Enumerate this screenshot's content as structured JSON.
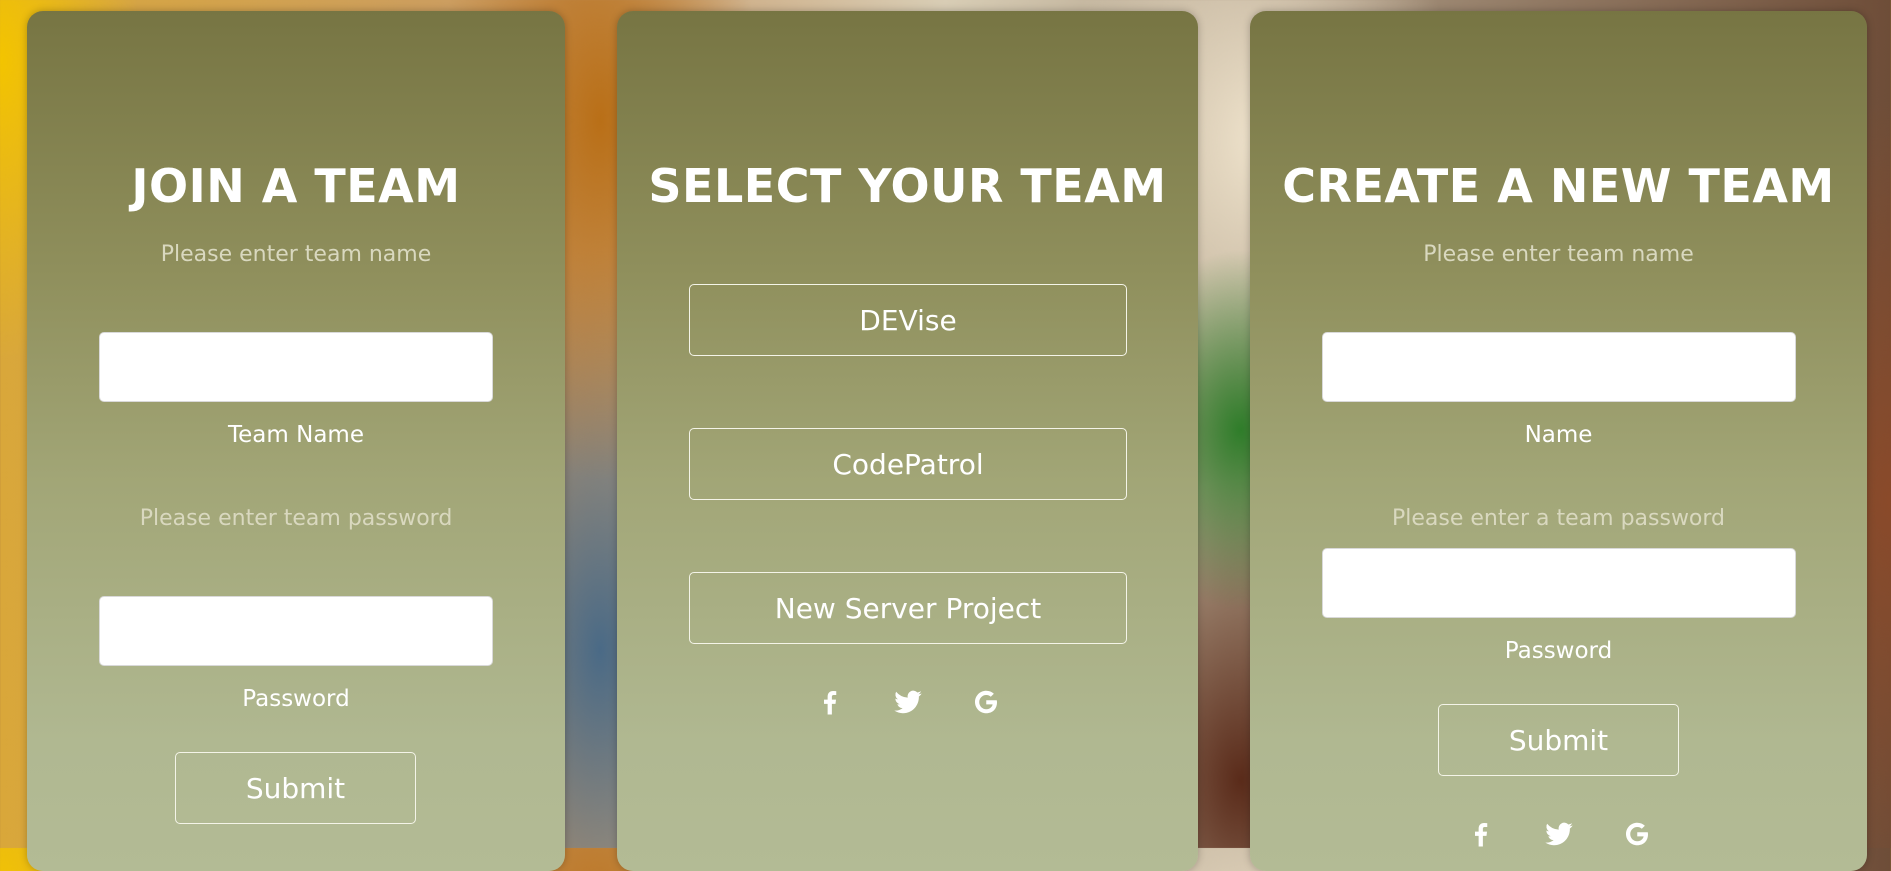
{
  "join": {
    "title": "JOIN A TEAM",
    "name_hint": "Please enter team name",
    "name_label": "Team Name",
    "password_hint": "Please enter team password",
    "password_label": "Password",
    "submit_label": "Submit"
  },
  "select": {
    "title": "SELECT YOUR TEAM",
    "teams": [
      "DEVise",
      "CodePatrol",
      "New Server Project"
    ],
    "socials": [
      "facebook-icon",
      "twitter-icon",
      "google-icon"
    ]
  },
  "create": {
    "title": "CREATE A NEW TEAM",
    "name_hint": "Please enter team name",
    "name_label": "Name",
    "password_hint": "Please enter a team password",
    "password_label": "Password",
    "submit_label": "Submit",
    "socials": [
      "facebook-icon",
      "twitter-icon",
      "google-icon"
    ]
  }
}
